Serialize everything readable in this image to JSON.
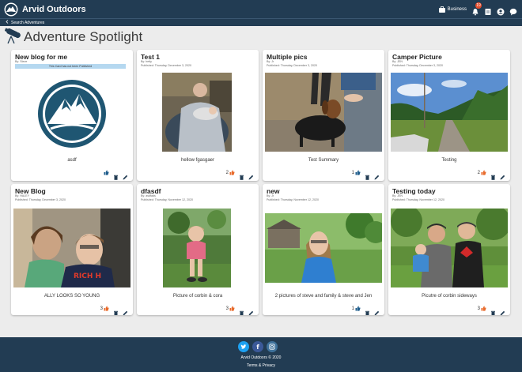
{
  "app": {
    "brand": "Arvid Outdoors",
    "business_label": "Business",
    "notification_count": "19"
  },
  "nav": {
    "back_label": "Search Adventures"
  },
  "page": {
    "title": "Adventure Spotlight"
  },
  "cards": [
    {
      "title": "New blog for me",
      "by": "By: Steve",
      "notice": "This Card has not been Published",
      "summary": "asdf",
      "likes": ""
    },
    {
      "title": "Test 1",
      "by": "By: betty",
      "published": "Published: Thursday, December 3, 2020",
      "summary": "hellow fgasgaer",
      "likes": "2"
    },
    {
      "title": "Multiple pics",
      "by": "By: Jr",
      "published": "Published: Thursday, December 3, 2020",
      "summary": "Test Summary",
      "likes": "1"
    },
    {
      "title": "Camper Picture",
      "by": "By: JEN",
      "published": "Published: Thursday, December 3, 2020",
      "summary": "Testing",
      "likes": "2"
    },
    {
      "title": "New Blog",
      "by": "By: HALEY",
      "published": "Published: Thursday, December 3, 2020",
      "summary": "ALLY LOOKS SO YOUNG",
      "likes": "3"
    },
    {
      "title": "dfasdf",
      "by": "By: asdfads",
      "published": "Published: Thursday, November 12, 2020",
      "summary": "Picture of corbin & cora",
      "likes": "3"
    },
    {
      "title": "new",
      "by": "By: Jr",
      "published": "Published: Thursday, November 12, 2020",
      "summary": "2 pictures of steve and family & steve and Jen",
      "likes": "1"
    },
    {
      "title": "Testing today",
      "by": "By: JEN",
      "published": "Published: Thursday, November 12, 2020",
      "summary": "Picutre of corbin sideways",
      "likes": "3"
    }
  ],
  "footer": {
    "copyright": "Arvid Outdoors © 2020",
    "terms": "Terms & Privacy"
  },
  "colors": {
    "navbar": "#223c53",
    "page_bg": "#ececec",
    "like_blue": "#1f5d8c",
    "like_orange": "#e86a2b",
    "notice_bg": "#b5d8f0"
  },
  "icons": {
    "brand": "mountain-logo-icon",
    "business": "briefcase-icon",
    "notifications": "bell-icon",
    "docs": "document-icon",
    "profile": "user-icon",
    "chat": "chat-bubble-icon",
    "back": "chevron-left-icon",
    "like": "thumbs-up-icon",
    "delete": "trash-icon",
    "edit": "pencil-icon",
    "twitter": "twitter-icon",
    "facebook": "facebook-icon",
    "instagram": "instagram-icon"
  }
}
